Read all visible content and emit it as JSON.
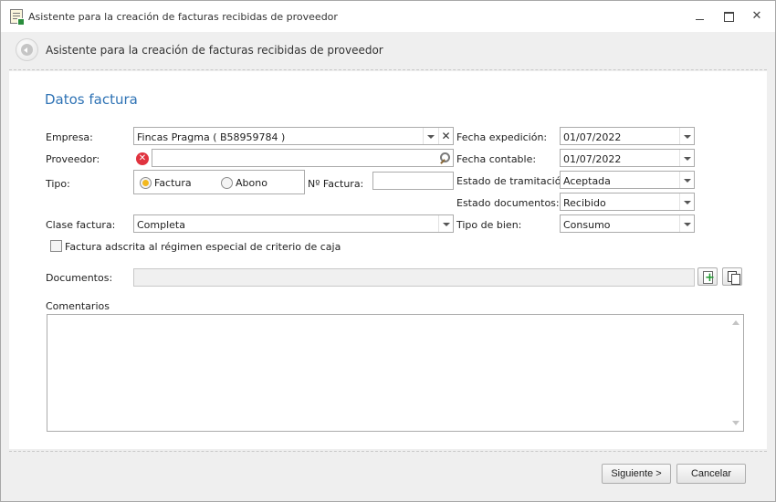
{
  "window": {
    "title": "Asistente para la creación de facturas recibidas de proveedor",
    "minimize_glyph": "",
    "close_glyph": "✕"
  },
  "header": {
    "title": "Asistente para la creación de facturas recibidas de proveedor"
  },
  "section": {
    "title": "Datos factura"
  },
  "form": {
    "empresa": {
      "label": "Empresa:",
      "value": "Fincas Pragma ( B58959784 )"
    },
    "proveedor": {
      "label": "Proveedor:",
      "value": "",
      "error_glyph": "✕"
    },
    "tipo": {
      "label": "Tipo:",
      "options": [
        {
          "label": "Factura",
          "selected": true
        },
        {
          "label": "Abono",
          "selected": false
        }
      ]
    },
    "num_factura": {
      "label": "Nº Factura:",
      "value": ""
    },
    "clase_factura": {
      "label": "Clase factura:",
      "value": "Completa"
    },
    "criterio_caja": {
      "label": "Factura adscrita al régimen especial de criterio de caja",
      "checked": false
    },
    "fecha_expedicion": {
      "label": "Fecha expedición:",
      "value": "01/07/2022"
    },
    "fecha_contable": {
      "label": "Fecha contable:",
      "value": "01/07/2022"
    },
    "estado_tramitacion": {
      "label": "Estado de tramitación:",
      "value": "Aceptada"
    },
    "estado_documentos": {
      "label": "Estado documentos:",
      "value": "Recibido"
    },
    "tipo_bien": {
      "label": "Tipo de bien:",
      "value": "Consumo"
    },
    "documentos": {
      "label": "Documentos:",
      "value": ""
    },
    "comentarios": {
      "label": "Comentarios",
      "value": ""
    }
  },
  "footer": {
    "next_label": "Siguiente >",
    "cancel_label": "Cancelar"
  },
  "colors": {
    "section_title": "#2f73b5",
    "error": "#e0333f",
    "radio_selected": "#f2b81e"
  },
  "icons": [
    "app-document-icon",
    "minimize-icon",
    "maximize-icon",
    "close-icon",
    "back-arrow-icon",
    "error-icon",
    "search-icon",
    "clear-icon",
    "chevron-down-icon",
    "add-document-icon",
    "copy-icon"
  ]
}
